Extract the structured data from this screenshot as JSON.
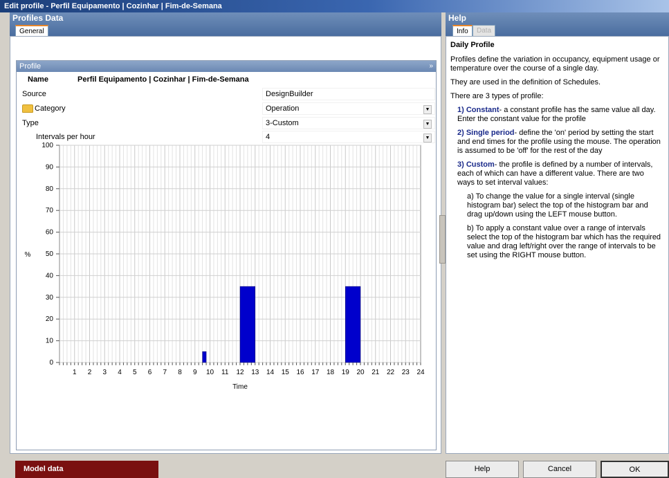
{
  "window": {
    "title": "Edit profile - Perfil Equipamento | Cozinhar | Fim-de-Semana"
  },
  "left_panel": {
    "title": "Profiles Data",
    "tabs": [
      {
        "label": "General",
        "active": true
      }
    ],
    "section_title": "Profile",
    "collapse_symbol": "»",
    "name_label": "Name",
    "name_value": "Perfil Equipamento | Cozinhar | Fim-de-Semana",
    "source_label": "Source",
    "source_value": "DesignBuilder",
    "category_label": "Category",
    "category_value": "Operation",
    "type_label": "Type",
    "type_value": "3-Custom",
    "intervals_label": "Intervals per hour",
    "intervals_value": "4"
  },
  "chart_data": {
    "type": "bar",
    "xlabel": "Time",
    "ylabel": "%",
    "ylim": [
      0,
      100
    ],
    "yticks": [
      0,
      10,
      20,
      30,
      40,
      50,
      60,
      70,
      80,
      90,
      100
    ],
    "xlim": [
      0,
      24
    ],
    "xticks": [
      1,
      2,
      3,
      4,
      5,
      6,
      7,
      8,
      9,
      10,
      11,
      12,
      13,
      14,
      15,
      16,
      17,
      18,
      19,
      20,
      21,
      22,
      23,
      24
    ],
    "intervals_per_hour": 4,
    "grid": true,
    "bars": [
      {
        "start": 9.5,
        "end": 9.75,
        "value": 5
      },
      {
        "start": 12.0,
        "end": 13.0,
        "value": 35
      },
      {
        "start": 19.0,
        "end": 20.0,
        "value": 35
      }
    ],
    "bar_color": "#0000cc"
  },
  "help": {
    "title": "Help",
    "tabs": [
      {
        "label": "Info",
        "active": true
      },
      {
        "label": "Data",
        "active": false
      }
    ],
    "heading": "Daily Profile",
    "p1": "Profiles define the variation in occupancy, equipment usage or temperature over the course of a single day.",
    "p2": "They are used in the definition of Schedules.",
    "p3": "There are 3 types of profile:",
    "item1_num": "1) Constant",
    "item1_text": "- a constant profile has the same value all day.  Enter the constant value for the profile",
    "item2_num": "2) Single period",
    "item2_text": "- define the 'on' period by setting the start and end times for the profile using the mouse. The operation is assumed to be 'off' for the rest of the day",
    "item3_num": "3) Custom",
    "item3_text": "- the profile is defined by a number of intervals, each of which can have a different value. There are two ways to set interval values:",
    "item3a": "a) To change the value for a single interval (single histogram bar) select the top of the histogram bar and drag up/down using the LEFT mouse button.",
    "item3b": "b) To apply a constant value over a range of intervals select the top of the histogram bar which has the required value and drag left/right over the range of intervals to be set using the RIGHT mouse button."
  },
  "footer": {
    "model_data": "Model data",
    "help": "Help",
    "cancel": "Cancel",
    "ok": "OK"
  }
}
